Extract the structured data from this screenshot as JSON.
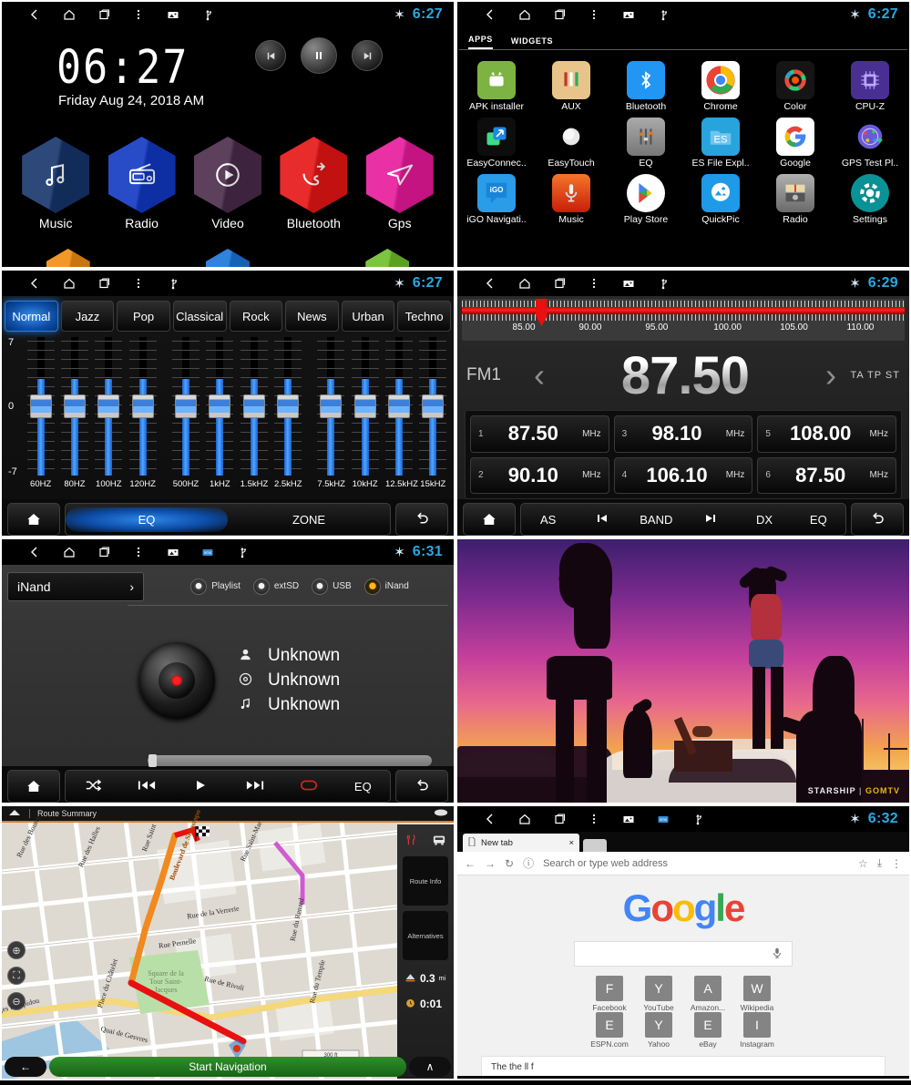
{
  "statusbar": {
    "icons": [
      "back-icon",
      "home-icon",
      "recents-icon",
      "overflow-icon",
      "image-icon",
      "usb-icon"
    ],
    "bluetooth": "✶",
    "times": {
      "home": "6:27",
      "drawer": "6:27",
      "eq": "6:27",
      "radio": "6:29",
      "music": "6:31",
      "chrome": "6:32"
    }
  },
  "home": {
    "clock": "06:27",
    "date": "Friday Aug 24, 2018 AM",
    "media_buttons": [
      "prev",
      "pause",
      "next"
    ],
    "shortcuts": [
      {
        "label": "Music",
        "color": "#15346b",
        "icon": "♫"
      },
      {
        "label": "Radio",
        "color": "#1038c2",
        "icon": "▣"
      },
      {
        "label": "Video",
        "color": "#4a2a4a",
        "icon": "▶"
      },
      {
        "label": "Bluetooth",
        "color": "#e61414",
        "icon": "☎"
      },
      {
        "label": "Gps",
        "color": "#e8189b",
        "icon": "➤"
      }
    ],
    "dock": [
      {
        "name": "brightness",
        "color": "#f08c10",
        "icon": "☽"
      },
      {
        "name": "home",
        "color": "#1a74d8",
        "icon": "⌂"
      },
      {
        "name": "settings",
        "color": "#6dbe2a",
        "icon": "⚙"
      }
    ]
  },
  "drawer": {
    "tabs": [
      "APPS",
      "WIDGETS"
    ],
    "active_tab": "APPS",
    "apps": [
      {
        "label": "APK installer",
        "icon": "◯",
        "bg": "#7cb342",
        "fg": "#ffffff"
      },
      {
        "label": "AUX",
        "icon": "‖",
        "bg": "#e8c48a",
        "fg": "#3a2a10"
      },
      {
        "label": "Bluetooth",
        "icon": "✶",
        "bg": "#2196f3",
        "fg": "#ffffff"
      },
      {
        "label": "Chrome",
        "icon": "◉",
        "bg": "#ffffff",
        "fg": "#4285f4"
      },
      {
        "label": "Color",
        "icon": "◉",
        "bg": "#1a1a1a",
        "fg": "#ff4444"
      },
      {
        "label": "CPU-Z",
        "icon": "▦",
        "bg": "#4a2f93",
        "fg": "#c8b8ff"
      },
      {
        "label": "EasyConnec..",
        "icon": "↗",
        "bg": "#101010",
        "fg": "#3ddc84"
      },
      {
        "label": "EasyTouch",
        "icon": "●",
        "bg": "#000000",
        "fg": "#dddddd"
      },
      {
        "label": "EQ",
        "icon": "≡",
        "bg": "#8d8d8d",
        "fg": "#e06a10"
      },
      {
        "label": "ES File Expl..",
        "icon": "ES",
        "bg": "#29a3dc",
        "fg": "#ffffff"
      },
      {
        "label": "Google",
        "icon": "G",
        "bg": "#ffffff",
        "fg": "#4285f4"
      },
      {
        "label": "GPS Test Pl..",
        "icon": "☉",
        "bg": "#5a4ec8",
        "fg": "#ffffff"
      },
      {
        "label": "iGO Navigati..",
        "icon": "iGO",
        "bg": "#2b9ce8",
        "fg": "#ffffff"
      },
      {
        "label": "Music",
        "icon": "Ἲ4",
        "bg": "#e0461a",
        "fg": "#ffffff"
      },
      {
        "label": "Play Store",
        "icon": "▶",
        "bg": "#ffffff",
        "fg": "#34a853"
      },
      {
        "label": "QuickPic",
        "icon": "◰",
        "bg": "#1e9ae8",
        "fg": "#ffffff"
      },
      {
        "label": "Radio",
        "icon": "▤",
        "bg": "#8d8d8d",
        "fg": "#e02020"
      },
      {
        "label": "Settings",
        "icon": "⚙",
        "bg": "#0a9396",
        "fg": "#ffffff"
      }
    ]
  },
  "eq": {
    "presets": [
      "Normal",
      "Jazz",
      "Pop",
      "Classical",
      "Rock",
      "News",
      "Urban",
      "Techno"
    ],
    "active_preset": "Normal",
    "scale": {
      "max": "7",
      "mid": "0",
      "min": "-7"
    },
    "bands": [
      {
        "label": "60HZ",
        "value": 0
      },
      {
        "label": "80HZ",
        "value": 0
      },
      {
        "label": "100HZ",
        "value": 0
      },
      {
        "label": "120HZ",
        "value": 0
      },
      {
        "label": "500HZ",
        "value": 0
      },
      {
        "label": "1kHZ",
        "value": 0
      },
      {
        "label": "1.5kHZ",
        "value": 0
      },
      {
        "label": "2.5kHZ",
        "value": 0
      },
      {
        "label": "7.5kHZ",
        "value": 0
      },
      {
        "label": "10kHZ",
        "value": 0
      },
      {
        "label": "12.5kHZ",
        "value": 0
      },
      {
        "label": "15kHZ",
        "value": 0
      }
    ],
    "toolbar": {
      "home": "⌂",
      "eq": "EQ",
      "zone": "ZONE",
      "back": "↩"
    }
  },
  "radio": {
    "band": "FM1",
    "frequency": "87.50",
    "scale_ticks": [
      "85.00",
      "90.00",
      "95.00",
      "100.00",
      "105.00",
      "110.00"
    ],
    "rds_flags": "TA TP ST",
    "prev_arrow": "‹",
    "next_arrow": "›",
    "presets": [
      {
        "num": "1",
        "freq": "87.50",
        "unit": "MHz"
      },
      {
        "num": "2",
        "freq": "90.10",
        "unit": "MHz"
      },
      {
        "num": "3",
        "freq": "98.10",
        "unit": "MHz"
      },
      {
        "num": "4",
        "freq": "106.10",
        "unit": "MHz"
      },
      {
        "num": "5",
        "freq": "108.00",
        "unit": "MHz"
      },
      {
        "num": "6",
        "freq": "87.50",
        "unit": "MHz"
      }
    ],
    "toolbar": {
      "home": "⌂",
      "as": "AS",
      "prev": "⏮",
      "band": "BAND",
      "next": "⏭",
      "dx": "DX",
      "eq": "EQ",
      "back": "↩"
    }
  },
  "music": {
    "folder": "iNand",
    "folder_chevron": "›",
    "sources": [
      {
        "label": "Playlist",
        "active": false
      },
      {
        "label": "extSD",
        "active": false
      },
      {
        "label": "USB",
        "active": false
      },
      {
        "label": "iNand",
        "active": true
      }
    ],
    "meta": [
      {
        "icon": "὆4",
        "text": "Unknown"
      },
      {
        "icon": "◉",
        "text": "Unknown"
      },
      {
        "icon": "♫",
        "text": "Unknown"
      }
    ],
    "toolbar": {
      "home": "⌂",
      "shuffle": "⤨",
      "prev": "⏮",
      "play": "▶",
      "next": "⏭",
      "repeat": "↺",
      "eq": "EQ",
      "back": "↩"
    }
  },
  "video": {
    "watermark_left": "STARSHIP",
    "watermark_right": "GOMTV"
  },
  "nav": {
    "title": "Route Summary",
    "side_buttons": [
      "Route Info",
      "Alternatives"
    ],
    "distance": "0.3",
    "distance_unit": "mi",
    "time": "0:01",
    "start_button": "Start Navigation",
    "back_arrow": "←",
    "up_arrow": "∧",
    "zoom_in": "⊕",
    "zoom_center": "⛶",
    "zoom_out": "⊖",
    "road_labels": [
      "Rue des Bourdo",
      "Rue des Halles",
      "Rue Saint",
      "Boulevard de Sébastopo",
      "Rue Saint-Mar",
      "Rue de la Verrerie",
      "Rue Pernelle",
      "Rue du Renard",
      "Rue de Rivoli",
      "Rue du Temple",
      "Square de la Tour Saint-Jacques",
      "Place du Châtelet",
      "Quai de Gesvres",
      "ges Pompidou"
    ]
  },
  "chrome": {
    "tab_title": "New tab",
    "tab_close": "×",
    "nav": {
      "back": "←",
      "forward": "→",
      "reload": "↻",
      "info": "ⓘ",
      "star": "☆",
      "download": "⤓",
      "menu": "⋮"
    },
    "omnibox_placeholder": "Search or type web address",
    "logo": "Google",
    "search_mic": "Ἲ4",
    "tiles": [
      {
        "letter": "F",
        "label": "Facebook"
      },
      {
        "letter": "Y",
        "label": "YouTube"
      },
      {
        "letter": "A",
        "label": "Amazon..."
      },
      {
        "letter": "W",
        "label": "Wikipedia"
      },
      {
        "letter": "E",
        "label": "ESPN.com"
      },
      {
        "letter": "Y",
        "label": "Yahoo"
      },
      {
        "letter": "E",
        "label": "eBay"
      },
      {
        "letter": "I",
        "label": "Instagram"
      }
    ],
    "card_text": "The the ll f"
  }
}
